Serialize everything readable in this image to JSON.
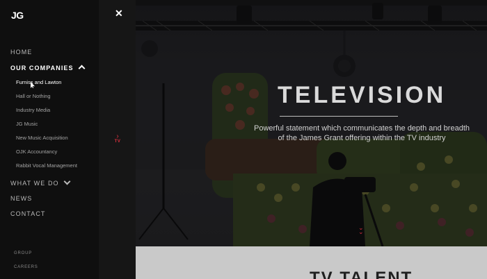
{
  "nav": {
    "logo": "JG",
    "items": [
      {
        "label": "HOME"
      },
      {
        "label": "OUR COMPANIES"
      },
      {
        "label": "WHAT WE DO"
      },
      {
        "label": "NEWS"
      },
      {
        "label": "CONTACT"
      }
    ],
    "companies": [
      "Furniss and Lawton",
      "Hall or Nothing",
      "Industry Media",
      "JG Music",
      "New Music Acquisition",
      "OJK Accountancy",
      "Rabbit Vocal Management"
    ],
    "footer": [
      "GROUP",
      "CAREERS"
    ],
    "close_icon": "close-icon"
  },
  "side_marker": {
    "label": "TV",
    "icon": "chevron-right-icon",
    "color": "#e0303f"
  },
  "hero": {
    "title": "TELEVISION",
    "text": "Powerful statement which communicates the depth and breadth of the James Grant offering within the TV industry",
    "scroll_icon": "double-chevron-down-icon"
  },
  "section": {
    "title": "TV TALENT"
  },
  "colors": {
    "accent": "#e0303f",
    "nav_bg": "#0f0f0f",
    "section_bg": "#c9c9c9"
  }
}
